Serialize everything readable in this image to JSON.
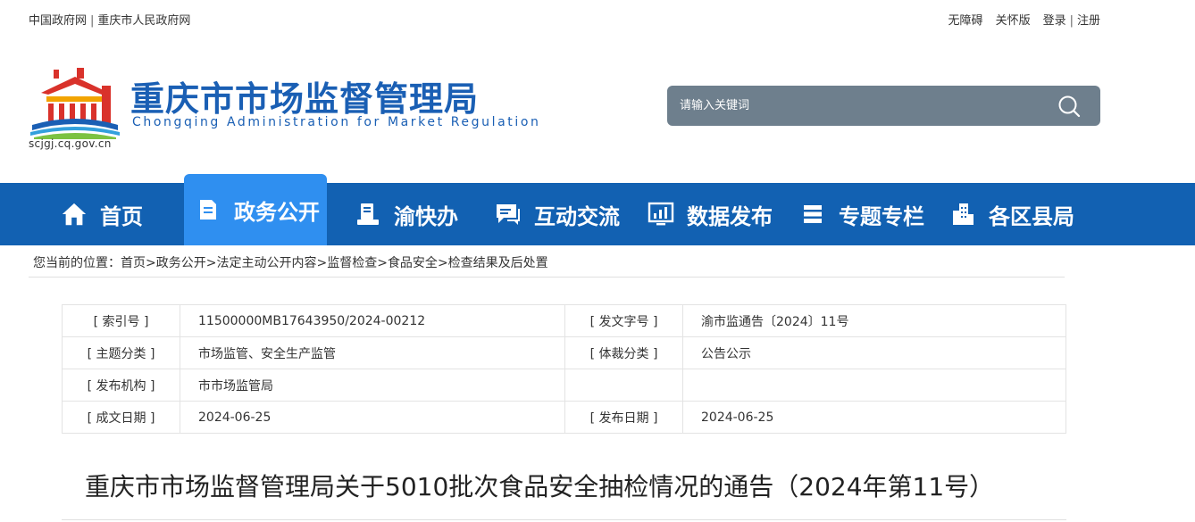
{
  "topbar": {
    "links_left": [
      "中国政府网",
      "重庆市人民政府网"
    ],
    "link_accessibility": "无障碍",
    "link_care": "关怀版",
    "link_login": "登录",
    "link_register": "注册",
    "separator": "|"
  },
  "header": {
    "title": "重庆市市场监督管理局",
    "subtitle": "Chongqing  Administration for Market Regulation",
    "url": "scjgj.cq.gov.cn",
    "logo_icon": "tiananmen-emblem-icon"
  },
  "search": {
    "placeholder": "请输入关键词",
    "icon": "search-icon"
  },
  "nav": {
    "items": [
      {
        "label": "首页",
        "icon": "home-icon"
      },
      {
        "label": "政务公开",
        "icon": "document-icon"
      },
      {
        "label": "渝快办",
        "icon": "service-icon"
      },
      {
        "label": "互动交流",
        "icon": "chat-icon"
      },
      {
        "label": "数据发布",
        "icon": "chart-icon"
      },
      {
        "label": "专题专栏",
        "icon": "stack-icon"
      },
      {
        "label": "各区县局",
        "icon": "building-icon"
      }
    ],
    "active_index": 1
  },
  "breadcrumb": {
    "prefix": "您当前的位置：",
    "items": [
      "首页",
      "政务公开",
      "法定主动公开内容",
      "监督检查",
      "食品安全",
      "检查结果及后处置"
    ],
    "separator": ">"
  },
  "meta": {
    "rows": [
      {
        "k1": "[ 索引号 ]",
        "v1": "11500000MB17643950/2024-00212",
        "k2": "[ 发文字号 ]",
        "v2": "渝市监通告〔2024〕11号"
      },
      {
        "k1": "[ 主题分类 ]",
        "v1": "市场监管、安全生产监管",
        "k2": "[ 体裁分类 ]",
        "v2": "公告公示"
      },
      {
        "k1": "[ 发布机构 ]",
        "v1": "市市场监管局",
        "k2": "",
        "v2": ""
      },
      {
        "k1": "[ 成文日期 ]",
        "v1": "2024-06-25",
        "k2": "[ 发布日期 ]",
        "v2": "2024-06-25"
      }
    ]
  },
  "document": {
    "title": "重庆市市场监督管理局关于5010批次食品安全抽检情况的通告（2024年第11号）"
  },
  "colors": {
    "brand_blue": "#1261b2",
    "active_tab": "#2f8ff0",
    "search_bg": "#6e7f8d",
    "title_blue": "#1a5fb4"
  }
}
